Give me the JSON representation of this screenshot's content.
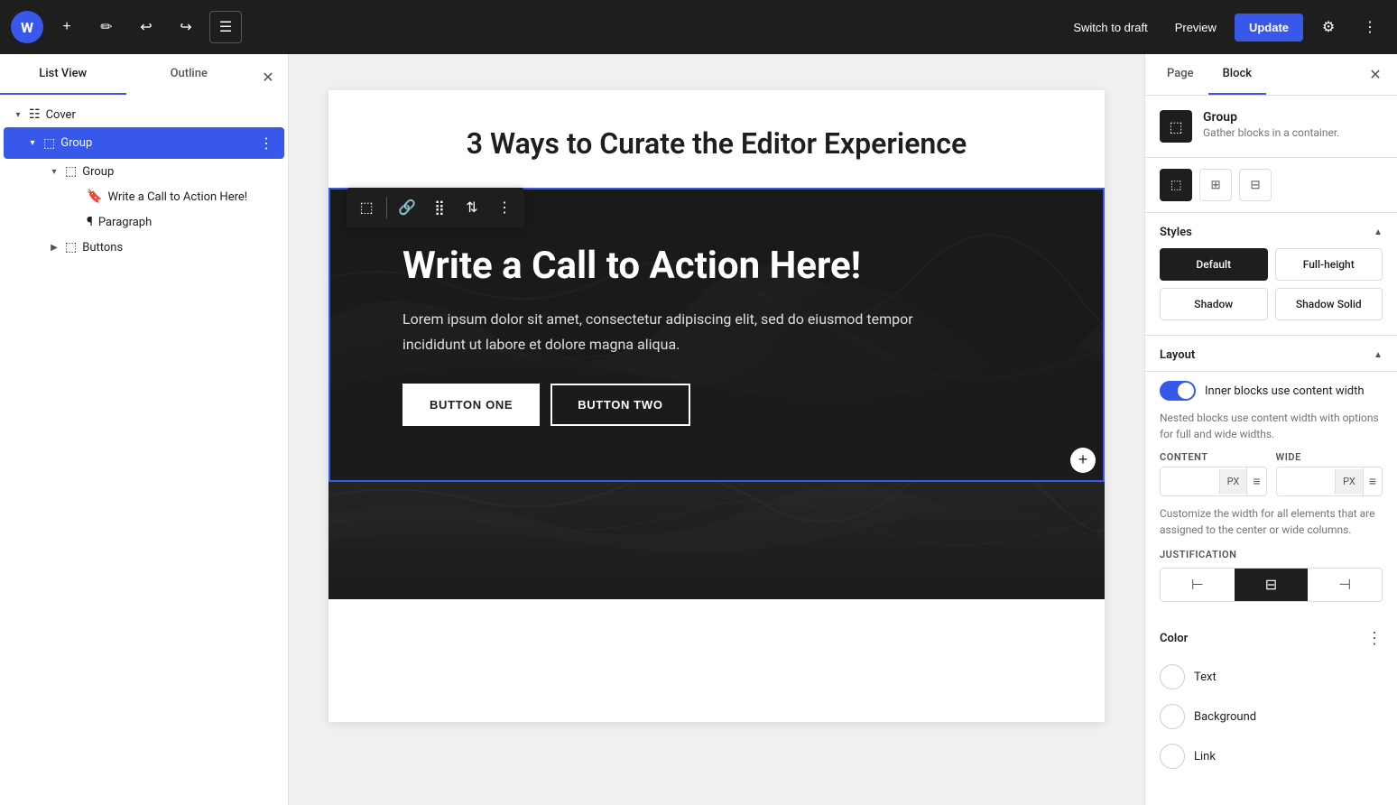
{
  "topbar": {
    "wp_logo": "W",
    "add_label": "+",
    "edit_label": "✎",
    "undo_label": "↩",
    "redo_label": "↪",
    "list_view_label": "☰",
    "switch_to_draft": "Switch to draft",
    "preview": "Preview",
    "update": "Update",
    "settings_icon": "⚙",
    "more_icon": "⋮"
  },
  "left_sidebar": {
    "tab_list_view": "List View",
    "tab_outline": "Outline",
    "close_icon": "✕",
    "tree": [
      {
        "id": "cover",
        "label": "Cover",
        "icon": "☷",
        "indent": 0,
        "toggle": "▾",
        "selected": false,
        "icon_type": "cover"
      },
      {
        "id": "group1",
        "label": "Group",
        "icon": "⬚",
        "indent": 1,
        "toggle": "▾",
        "selected": true,
        "icon_type": "group"
      },
      {
        "id": "group2",
        "label": "Group",
        "icon": "⬚",
        "indent": 2,
        "toggle": "▾",
        "selected": false,
        "icon_type": "group"
      },
      {
        "id": "write-cta",
        "label": "Write a Call to Action Here!",
        "icon": "🔖",
        "indent": 3,
        "toggle": "",
        "selected": false,
        "icon_type": "heading"
      },
      {
        "id": "paragraph",
        "label": "Paragraph",
        "icon": "¶",
        "indent": 3,
        "toggle": "",
        "selected": false,
        "icon_type": "paragraph"
      },
      {
        "id": "buttons",
        "label": "Buttons",
        "icon": "⬚",
        "indent": 2,
        "toggle": "▶",
        "selected": false,
        "icon_type": "buttons"
      }
    ]
  },
  "canvas": {
    "page_title": "3 Ways to Curate the Editor Experience",
    "cover_heading": "Write a Call to Action Here!",
    "cover_paragraph": "Lorem ipsum dolor sit amet, consectetur adipiscing elit, sed do eiusmod tempor incididunt ut labore et dolore magna aliqua.",
    "button_one": "BUTTON ONE",
    "button_two": "BUTTON TWO",
    "add_icon": "+"
  },
  "right_sidebar": {
    "tab_page": "Page",
    "tab_block": "Block",
    "close_icon": "✕",
    "block_name": "Group",
    "block_desc": "Gather blocks in a container.",
    "block_icon": "⬚",
    "style_icons": [
      "⬚",
      "⊞",
      "⊟"
    ],
    "styles_section_title": "Styles",
    "styles_toggle": "▲",
    "styles": [
      {
        "label": "Default",
        "selected": true
      },
      {
        "label": "Full-height",
        "selected": false
      },
      {
        "label": "Shadow",
        "selected": false
      },
      {
        "label": "Shadow Solid",
        "selected": false
      }
    ],
    "layout_section_title": "Layout",
    "layout_toggle": "▲",
    "inner_blocks_label": "Inner blocks use content width",
    "inner_blocks_desc": "Nested blocks use content width with options for full and wide widths.",
    "content_label": "CONTENT",
    "wide_label": "WIDE",
    "content_unit": "PX",
    "wide_unit": "PX",
    "width_desc": "Customize the width for all elements that are assigned to the center or wide columns.",
    "justification_label": "JUSTIFICATION",
    "just_left": "⊣",
    "just_center": "⊞",
    "just_right": "⊢",
    "color_section_title": "Color",
    "color_more_icon": "⋮",
    "text_label": "Text",
    "background_label": "Background",
    "link_label": "Link"
  }
}
